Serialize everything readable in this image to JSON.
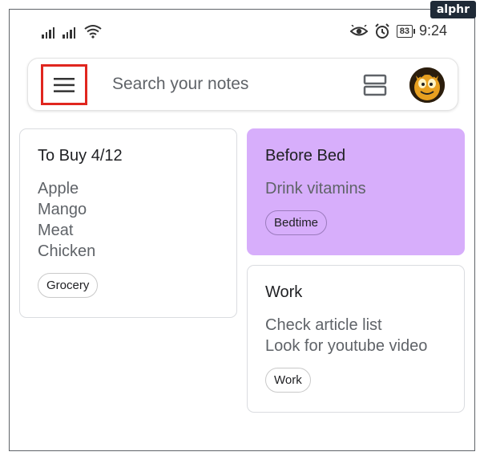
{
  "watermark": "alphr",
  "status_bar": {
    "time": "9:24",
    "battery": "83"
  },
  "search_bar": {
    "placeholder": "Search your notes"
  },
  "notes": [
    {
      "title": "To Buy 4/12",
      "lines": [
        "Apple",
        "Mango",
        "Meat",
        "Chicken"
      ],
      "label": "Grocery",
      "color": "#ffffff"
    },
    {
      "title": "Before Bed",
      "lines": [
        "Drink vitamins"
      ],
      "label": "Bedtime",
      "color": "#d7aefb"
    },
    {
      "title": "Work",
      "lines": [
        "Check article list",
        "Look for youtube video"
      ],
      "label": "Work",
      "color": "#ffffff"
    }
  ],
  "colors": {
    "highlight": "#e0261f",
    "purple_note": "#d7aefb"
  }
}
